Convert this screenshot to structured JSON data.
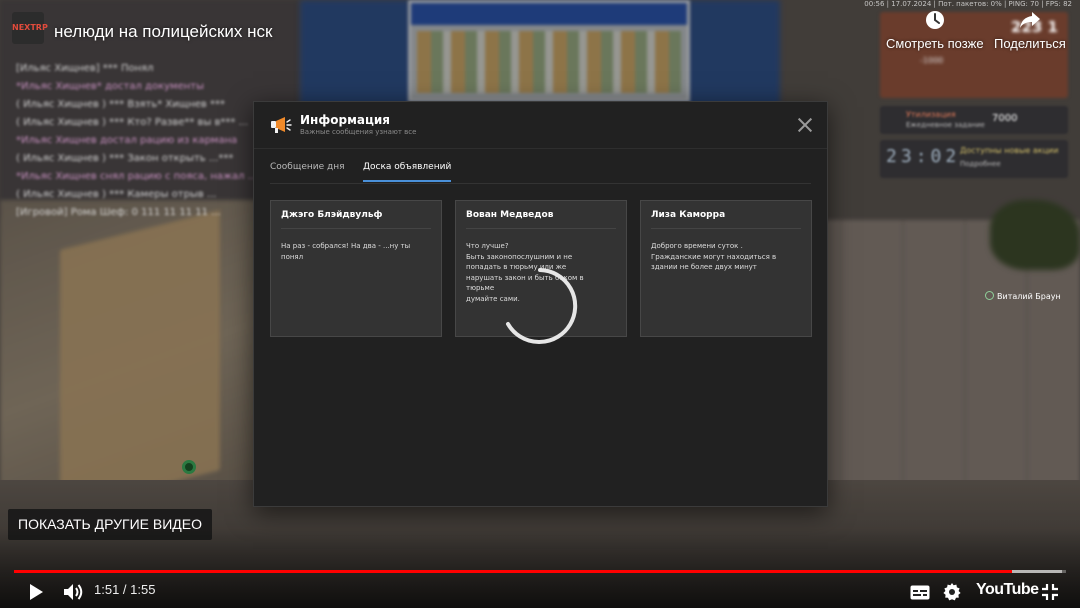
{
  "video": {
    "title": "нелюди на полицейских нск",
    "channel_logo_text": "NEXTRP",
    "current_time": "1:51",
    "total_time": "1:55",
    "time_separator": " / ",
    "progress_fraction": 0.949,
    "buffered_fraction": 0.996,
    "watch_later_label": "Смотреть позже",
    "share_label": "Поделиться",
    "more_videos_label": "ПОКАЗАТЬ ДРУГИЕ ВИДЕО",
    "brand_label": "YouTube",
    "accent_color": "#ff0000"
  },
  "game_hud": {
    "status_bar": "00:56 | 17.07.2024 | Пот. пакетов: 0% | PING: 70 | FPS: 82",
    "card_value": "223 1",
    "card_sub": "-1000",
    "utilization_title": "Утилизация",
    "utilization_sub": "Ежедневное задание",
    "utilization_amount": "7000",
    "timer_hours": "23",
    "timer_minutes": "02",
    "timer_title": "Доступны новые акции",
    "timer_sub": "Подробнее",
    "player_name": "Виталий Браун"
  },
  "chat_lines": [
    {
      "text": "[Ильяс Хищнев] *** Понял",
      "style": "white"
    },
    {
      "text": "*Ильяс Хищнев*  достал документы",
      "style": "pink"
    },
    {
      "text": "( Ильяс Хищнев ) *** Взять* Хищнев ***",
      "style": "white"
    },
    {
      "text": "( Ильяс Хищнев ) *** Кто? Разве** вы в*** ...",
      "style": "white"
    },
    {
      "text": "*Ильяс Хищнев достал рацию из кармана",
      "style": "pink"
    },
    {
      "text": "( Ильяс Хищнев ) *** Закон открыть ...***",
      "style": "white"
    },
    {
      "text": "*Ильяс Хищнев снял рацию с пояса, нажал ...",
      "style": "pink"
    },
    {
      "text": "( Ильяс Хищнев ) *** Камеры отрыв ...",
      "style": "white"
    },
    {
      "text": "[Игровой] Рома Шеф: 0 111 11 11 11 ...",
      "style": "white"
    }
  ],
  "dialog": {
    "title": "Информация",
    "subtitle": "Важные сообщения узнают все",
    "tabs": [
      {
        "label": "Сообщение дня",
        "active": false
      },
      {
        "label": "Доска объявлений",
        "active": true
      }
    ],
    "accent_color": "#4a90d9",
    "icon": "megaphone-icon",
    "announcements": [
      {
        "author": "Джэго Блэйдвульф",
        "text": "На раз - собрался! На два - ...ну ты\nпонял"
      },
      {
        "author": "Вован Медведов",
        "text": "Что лучше?\nБыть законопослушним и не\nпопадать в тюрьму или же\nнарушать закон и быть боком в\nтюрьме\nдумайте сами."
      },
      {
        "author": "Лиза Каморра",
        "text": "Доброго времени суток .\nГражданские могут находиться в\nздании не более двух минут"
      }
    ]
  }
}
